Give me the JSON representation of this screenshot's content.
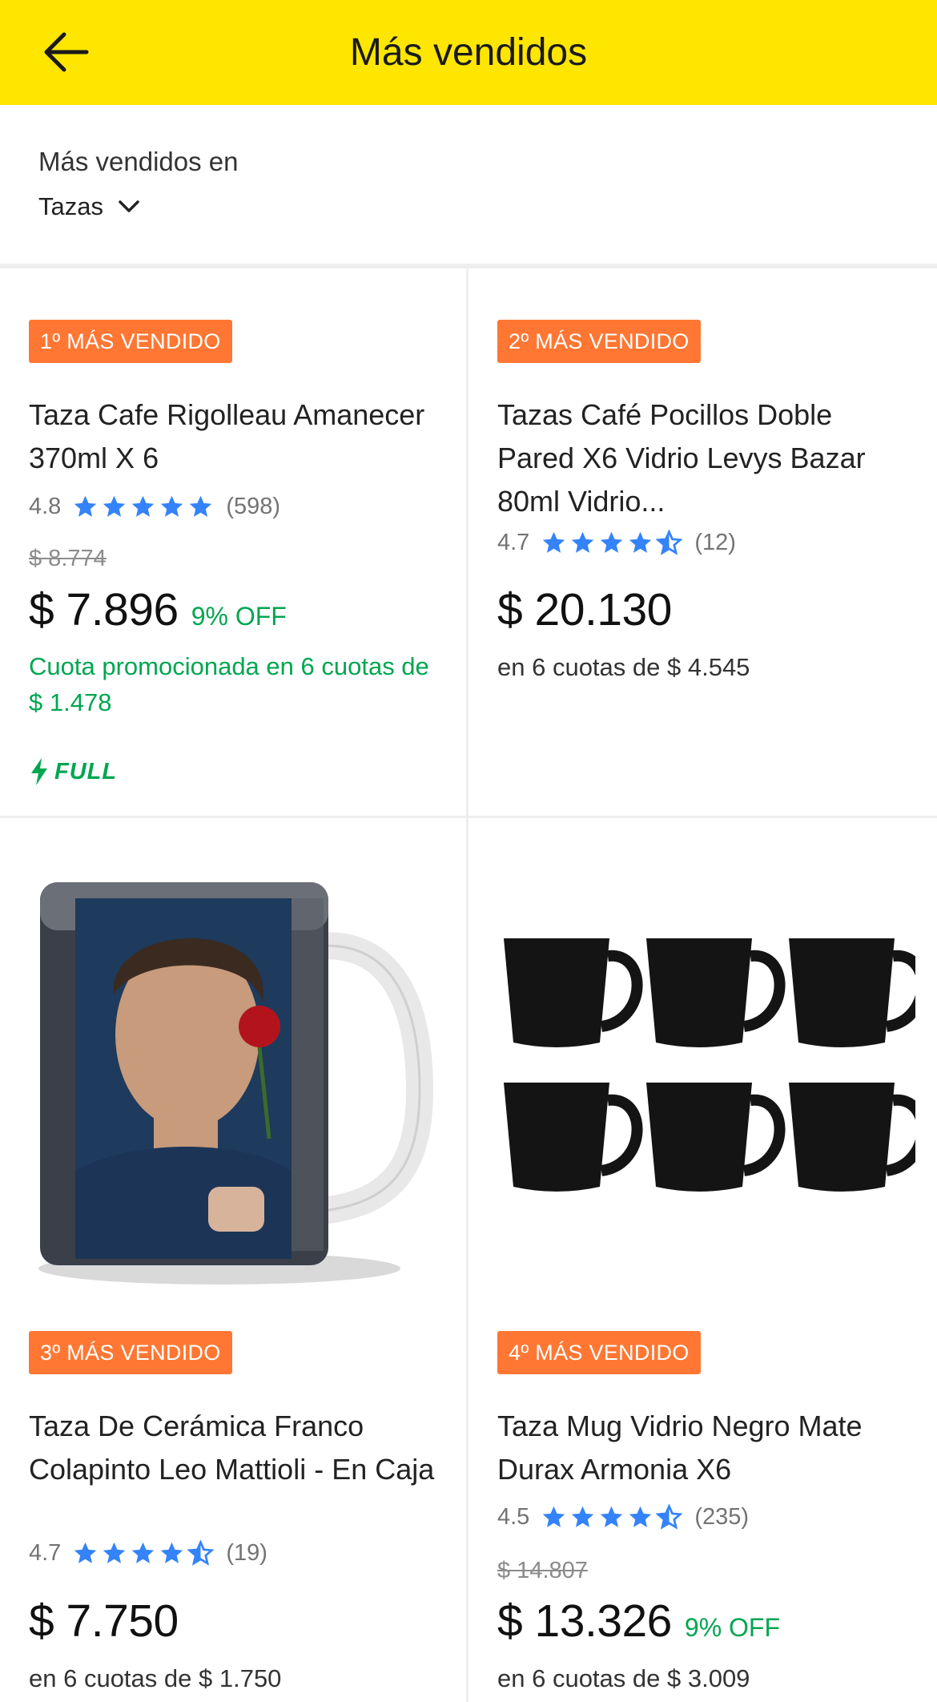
{
  "header": {
    "title": "Más vendidos",
    "back_icon": "arrow-left-icon",
    "background": "#ffe600"
  },
  "filter": {
    "label": "Más vendidos en",
    "selected": "Tazas"
  },
  "colors": {
    "badge": "#ff7733",
    "discount_green": "#00a650",
    "star_blue": "#3483fa"
  },
  "products": [
    {
      "badge": "1º MÁS VENDIDO",
      "title": "Taza Cafe Rigolleau Amanecer 370ml X 6",
      "rating": "4.8",
      "stars": 5,
      "reviews": "(598)",
      "old_price": "$ 8.774",
      "price": "$ 7.896",
      "discount": "9% OFF",
      "installments": "Cuota promocionada en 6 cuotas de $ 1.478",
      "shipping": "FULL"
    },
    {
      "badge": "2º MÁS VENDIDO",
      "title": "Tazas Café Pocillos Doble Pared X6 Vidrio Levys Bazar 80ml Vidrio...",
      "rating": "4.7",
      "stars": 4.5,
      "reviews": "(12)",
      "price": "$ 20.130",
      "installments": "en 6 cuotas de $ 4.545"
    },
    {
      "badge": "3º MÁS VENDIDO",
      "title": "Taza De Cerámica Franco Colapinto Leo Mattioli - En Caja",
      "rating": "4.7",
      "stars": 4.5,
      "reviews": "(19)",
      "price": "$ 7.750",
      "installments": "en 6 cuotas de $ 1.750"
    },
    {
      "badge": "4º MÁS VENDIDO",
      "title": "Taza Mug Vidrio Negro Mate Durax Armonia X6",
      "rating": "4.5",
      "stars": 4.5,
      "reviews": "(235)",
      "old_price": "$ 14.807",
      "price": "$ 13.326",
      "discount": "9% OFF",
      "installments": "en 6 cuotas de $ 3.009"
    }
  ]
}
